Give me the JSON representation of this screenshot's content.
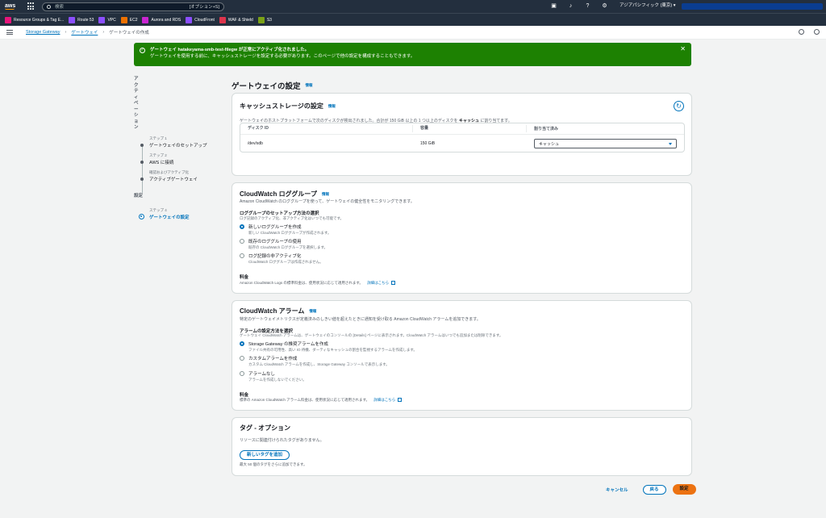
{
  "topnav": {
    "logo": "aws",
    "search_placeholder": "検索",
    "search_shortcut": "[オプション+S]",
    "icons": [
      "cloudshell-icon",
      "bell-icon",
      "help-icon",
      "gear-icon"
    ],
    "region": "アジアパシフィック (東京)"
  },
  "favorites": [
    {
      "label": "Resource Groups & Tag E...",
      "color": "#e7157b"
    },
    {
      "label": "Route 53",
      "color": "#8c4fff"
    },
    {
      "label": "VPC",
      "color": "#8c4fff"
    },
    {
      "label": "EC2",
      "color": "#ed7100"
    },
    {
      "label": "Aurora and RDS",
      "color": "#c925d1"
    },
    {
      "label": "CloudFront",
      "color": "#8c4fff"
    },
    {
      "label": "WAF & Shield",
      "color": "#dd344c"
    },
    {
      "label": "S3",
      "color": "#7aa116"
    }
  ],
  "breadcrumb": {
    "item1": "Storage Gateway",
    "item2": "ゲートウェイ",
    "current": "ゲートウェイの作成"
  },
  "flash": {
    "line1": "ゲートウェイ hatakeyama-smb-test-filegw が正常にアクティブ化されました。",
    "line2": "ゲートウェイを使用する前に、キャッシュストレージを設定する必要があります。このページで他の設定を構成することもできます。"
  },
  "steps": {
    "section1": "アクティベーション",
    "items": [
      {
        "label": "ステップ 1",
        "name": "ゲートウェイのセットアップ"
      },
      {
        "label": "ステップ 2",
        "name": "AWS に接続"
      },
      {
        "label": "確認およびアクティブ化",
        "name": "アクティブゲートウェイ"
      }
    ],
    "section2": "設定",
    "current": {
      "label": "ステップ 4",
      "name": "ゲートウェイの設定"
    }
  },
  "page": {
    "title": "ゲートウェイの設定",
    "info": "情報"
  },
  "cache": {
    "title": "キャッシュストレージの設定",
    "info": "情報",
    "desc_prefix": "ゲートウェイのホストプラットフォームで次のディスクが検出されました。合計が 150 GiB 以上の 1 つ以上のディスクを",
    "desc_bold": "キャッシュ",
    "desc_suffix": "に割り当てます。",
    "columns": [
      "ディスク ID",
      "容量",
      "割り当て済み"
    ],
    "rows": [
      {
        "disk": "/dev/sdb",
        "capacity": "150 GiB",
        "allocated": "キャッシュ"
      }
    ]
  },
  "loggroup": {
    "title": "CloudWatch ロググループ",
    "info": "情報",
    "desc": "Amazon CloudWatch のロググループを使って、ゲートウェイの健全性をモニタリングできます。",
    "method_title": "ロググループのセットアップ方法の選択",
    "method_desc": "ログ記録のアクティブ化、非アクティブ化はいつでも可能です。",
    "options": [
      {
        "label": "新しいロググループを作成",
        "sub": "新しい CloudWatch ロググループが作成されます。"
      },
      {
        "label": "既存のロググループの使用",
        "sub": "既存の CloudWatch ロググループを選択します。"
      },
      {
        "label": "ログ記録の非アクティブ化",
        "sub": "CloudWatch ロググループは作成されません。"
      }
    ],
    "pricing_title": "料金",
    "pricing_desc": "Amazon CloudWatch Logs の標準料金は、使用状況に応じて適用されます。",
    "pricing_link": "詳細はこちら"
  },
  "alarm": {
    "title": "CloudWatch アラーム",
    "info": "情報",
    "desc": "特定のゲートウェイメトリクスが定義済みのしきい値を超えたときに通知を受け取る Amazon CloudWatch アラームを追加できます。",
    "method_title": "アラームの設定方法を選択",
    "method_desc": "ゲートウェイ CloudWatch アラームは、ゲートウェイのコンソールの [Details] ページに表示されます。CloudWatch アラームはいつでも追加または削除できます。",
    "options": [
      {
        "label": "Storage Gateway の推奨アラームを作成",
        "sub": "ファイル共有の可用性、高い IO 待機、ダーティなキャッシュの割合を監視するアラームを作成します。"
      },
      {
        "label": "カスタムアラームを作成",
        "sub": "カスタム CloudWatch アラームを作成し、Storage Gateway コンソールで表示します。"
      },
      {
        "label": "アラームなし",
        "sub": "アラームを作成しないでください。"
      }
    ],
    "pricing_title": "料金",
    "pricing_desc": "標準の Amazon CloudWatch アラーム料金は、使用状況に応じて適用されます。",
    "pricing_link": "詳細はこちら"
  },
  "tags": {
    "title": "タグ - オプション",
    "empty": "リソースに関連付けられたタグがありません。",
    "add_button": "新しいタグを追加",
    "limit": "最大 50 個のタグをさらに追加できます。"
  },
  "footer": {
    "cancel": "キャンセル",
    "back": "戻る",
    "submit": "設定"
  }
}
